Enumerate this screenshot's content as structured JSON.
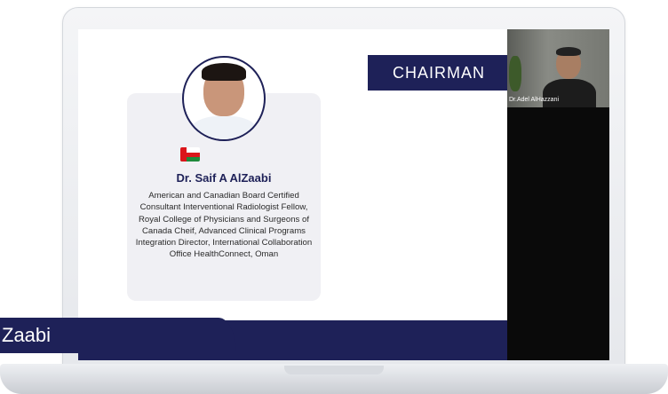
{
  "slide": {
    "role_banner": "CHAIRMAN",
    "card_background_text": "",
    "speaker_name": "Dr. Saif A AlZaabi",
    "speaker_description": "American and Canadian Board Certified Consultant Interventional Radiologist Fellow, Royal College of Physicians and Surgeons of Canada Cheif, Advanced Clinical Programs Integration Director, International Collaboration Office HealthConnect, Oman",
    "flag": "oman-flag-icon"
  },
  "webcam": {
    "participant_name": "Dr.Adel AlHazzani"
  },
  "lower_third": {
    "text": "Zaabi"
  },
  "colors": {
    "navy": "#1e2158",
    "card_bg": "#f0f0f4"
  }
}
